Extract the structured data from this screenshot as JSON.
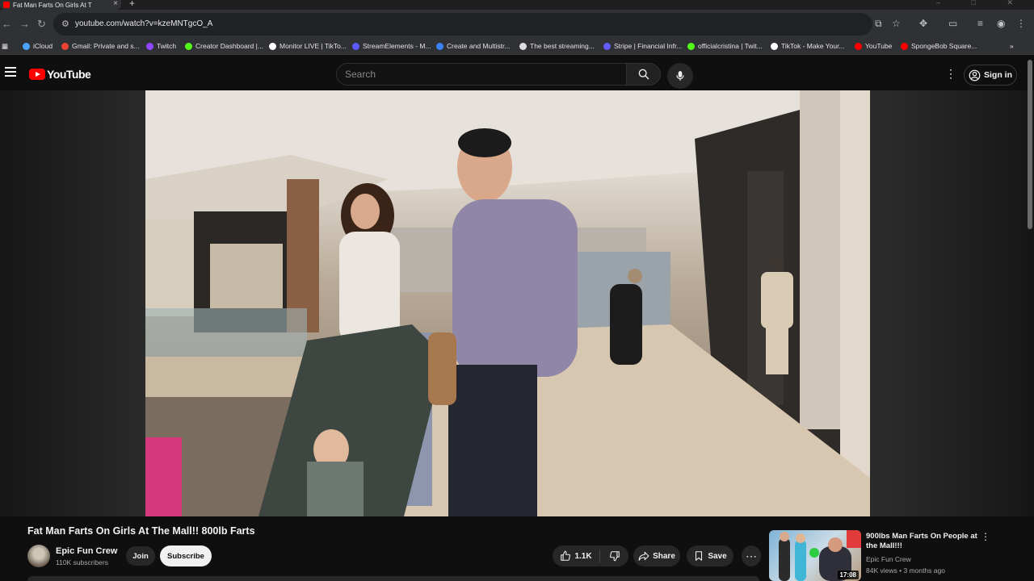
{
  "browser": {
    "tab_title": "Fat Man Farts On Girls At T",
    "url": "youtube.com/watch?v=kzeMNTgcO_A",
    "bookmarks": [
      {
        "label": "iCloud",
        "color": "#4aa3ff"
      },
      {
        "label": "Gmail: Private and s...",
        "color": "#ea4335"
      },
      {
        "label": "Twitch",
        "color": "#9146ff"
      },
      {
        "label": "Creator Dashboard |...",
        "color": "#53fc18"
      },
      {
        "label": "Monitor LIVE | TikTo...",
        "color": "#ffffff"
      },
      {
        "label": "StreamElements - M...",
        "color": "#5b5bff"
      },
      {
        "label": "Create and Multistr...",
        "color": "#3b82f6"
      },
      {
        "label": "The best streaming...",
        "color": "#dddddd"
      },
      {
        "label": "Stripe | Financial Infr...",
        "color": "#635bff"
      },
      {
        "label": "officialcristina | Twit...",
        "color": "#53fc18"
      },
      {
        "label": "TikTok - Make Your...",
        "color": "#ffffff"
      },
      {
        "label": "YouTube",
        "color": "#ff0000"
      },
      {
        "label": "SpongeBob Square...",
        "color": "#ff0000"
      }
    ]
  },
  "header": {
    "logo_text": "YouTube",
    "search_placeholder": "Search",
    "sign_in_label": "Sign in"
  },
  "video": {
    "title": "Fat Man Farts On Girls At The Mall!! 800lb Farts",
    "channel_name": "Epic Fun Crew",
    "subscribers": "110K subscribers",
    "join_label": "Join",
    "subscribe_label": "Subscribe",
    "like_count": "1.1K",
    "share_label": "Share",
    "save_label": "Save"
  },
  "recommended": {
    "title": "900lbs Man Farts On People at the Mall!!!",
    "channel": "Epic Fun Crew",
    "meta": "84K views • 3 months ago",
    "duration": "17:08"
  },
  "colors": {
    "brand_red": "#ff0000",
    "background": "#0f0f0f",
    "button_bg": "#272727"
  }
}
